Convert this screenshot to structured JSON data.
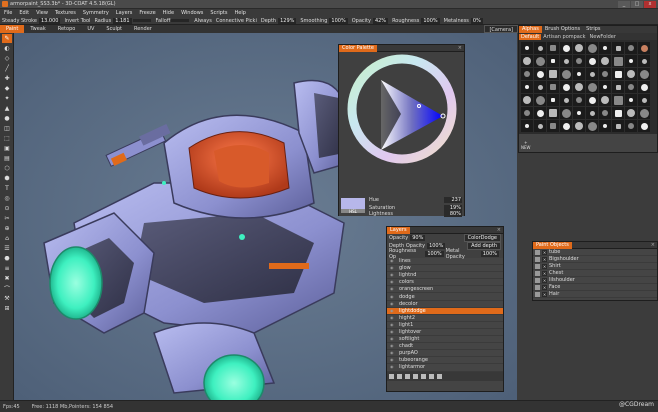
{
  "window": {
    "title": "armorpaint_SS3.3b* - 3D-COAT 4.5.18(GL)",
    "buttons": [
      "_",
      "□",
      "x"
    ]
  },
  "menu": [
    "File",
    "Edit",
    "View",
    "Textures",
    "Symmetry",
    "Layers",
    "Freeze",
    "Hide",
    "Windows",
    "Scripts",
    "Help"
  ],
  "options": {
    "mode": "Steady Stroke",
    "mode_val": "13.000",
    "invert": "Invert Tool",
    "radius_lbl": "Radius",
    "radius_val": "1.181",
    "falloff_lbl": "Falloff",
    "always": "Always",
    "connective": "Connective Picki",
    "depth_lbl": "Depth",
    "depth_val": "129%",
    "smooth_lbl": "Smoothing",
    "smooth_val": "100%",
    "opacity_lbl": "Opacity",
    "opacity_val": "42%",
    "rough_lbl": "Roughness",
    "rough_val": "100%",
    "metal_lbl": "Metalness",
    "metal_val": "0%"
  },
  "tabs": [
    {
      "label": "Paint",
      "active": true
    },
    {
      "label": "Tweak",
      "active": false
    },
    {
      "label": "Retopo",
      "active": false
    },
    {
      "label": "UV",
      "active": false
    },
    {
      "label": "Sculpt",
      "active": false
    },
    {
      "label": "Render",
      "active": false
    }
  ],
  "camera": "[Camera]",
  "tools": [
    "✎",
    "◐",
    "◇",
    "╱",
    "✚",
    "◆",
    "✦",
    "▲",
    "●",
    "◫",
    "⬚",
    "▣",
    "▤",
    "⬡",
    "⬢",
    "T",
    "◎",
    "⊙",
    "✂",
    "⊕",
    "⌂",
    "☰",
    "⬣",
    "≡",
    "✖",
    "⌒",
    "⚒",
    "⊞"
  ],
  "alphas": {
    "tabs": [
      {
        "label": "Alphas",
        "active": true
      },
      {
        "label": "Brush Options",
        "active": false
      },
      {
        "label": "Strips",
        "active": false
      }
    ],
    "sub": [
      {
        "label": "Default",
        "active": true
      },
      {
        "label": "Artisan pompack",
        "active": false
      },
      {
        "label": "NewFolder",
        "active": false
      }
    ],
    "new_label": "NEW"
  },
  "color_palette": {
    "title": "Color Palette",
    "hue_lbl": "Hue",
    "hue_val": "237",
    "sat_lbl": "Saturation",
    "sat_val": "19%",
    "light_lbl": "Lightness",
    "light_val": "80%",
    "swatch_color": "#b7b7ea",
    "swatch_lbl": "HSL"
  },
  "layers": {
    "title": "Layers",
    "opacity_lbl": "Opacity",
    "opacity_val": "90%",
    "blend": "ColorDodge",
    "depth_lbl": "Depth Opacity",
    "depth_val": "100%",
    "depth_mode": "Add depth",
    "rough_lbl": "Roughness Op",
    "rough_val": "100%",
    "metal_lbl": "Metal Opacity",
    "metal_val": "100%",
    "items": [
      "lines",
      "glow",
      "lightnd",
      "colors",
      "orangescreen",
      "dodge",
      "decolor",
      "lightdodge",
      "hight2",
      "light1",
      "lightover",
      "softlight",
      "chadt",
      "purpAO",
      "tubeorange",
      "lightarmor"
    ],
    "selected": "lightdodge"
  },
  "paint_objects": {
    "title": "Paint Objects",
    "items": [
      "tube",
      "Bigshoulder",
      "Shirt",
      "Chest",
      "lilshoulder",
      "Face",
      "Hair"
    ]
  },
  "status": {
    "fps": "Fps:45",
    "free": "Free: 1118 Mb,Pointers: 154 854",
    "watermark": "@CGDream"
  },
  "colors": {
    "accent": "#e06a1a",
    "viewport": "#5c7087",
    "glow": "#3ef0c0"
  }
}
